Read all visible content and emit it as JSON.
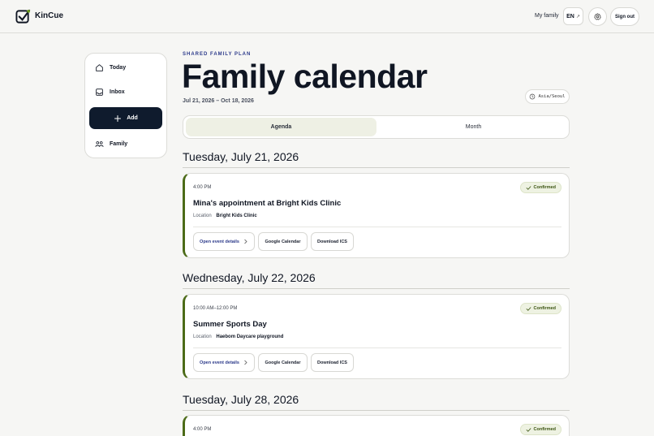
{
  "header": {
    "brand": "KinCue",
    "nav_family": "My family",
    "lang": "EN",
    "lang_arrow": "↗",
    "sign_out": "Sign out"
  },
  "sidebar": {
    "items": [
      {
        "label": "Today",
        "icon": "home-icon"
      },
      {
        "label": "Inbox",
        "icon": "inbox-icon"
      },
      {
        "label": "Add",
        "icon": "plus-icon"
      },
      {
        "label": "Family",
        "icon": "family-icon"
      }
    ]
  },
  "main": {
    "eyebrow": "SHARED FAMILY PLAN",
    "title": "Family calendar",
    "date_range": "Jul 21, 2026 – Oct 18, 2026",
    "timezone": "Asia/Seoul",
    "tabs": [
      {
        "label": "Agenda",
        "active": true
      },
      {
        "label": "Month",
        "active": false
      }
    ]
  },
  "days": [
    {
      "heading": "Tuesday, July 21, 2026",
      "event": {
        "time": "4:00 PM",
        "status": "Confirmed",
        "title": "Mina's appointment at Bright Kids Clinic",
        "location_label": "Location",
        "location": "Bright Kids Clinic",
        "actions": [
          "Open event details",
          "Google Calendar",
          "Download ICS"
        ]
      }
    },
    {
      "heading": "Wednesday, July 22, 2026",
      "event": {
        "time": "10:00 AM–12:00 PM",
        "status": "Confirmed",
        "title": "Summer Sports Day",
        "location_label": "Location",
        "location": "Haebom Daycare playground",
        "actions": [
          "Open event details",
          "Google Calendar",
          "Download ICS"
        ]
      }
    },
    {
      "heading": "Tuesday, July 28, 2026",
      "event": {
        "time": "4:00 PM",
        "status": "Confirmed"
      }
    }
  ],
  "colors": {
    "accent_navy": "#0f1b2d",
    "event_bar": "#4c6b18",
    "eyebrow": "#2c3a8a",
    "status_green": "#3c5512"
  }
}
